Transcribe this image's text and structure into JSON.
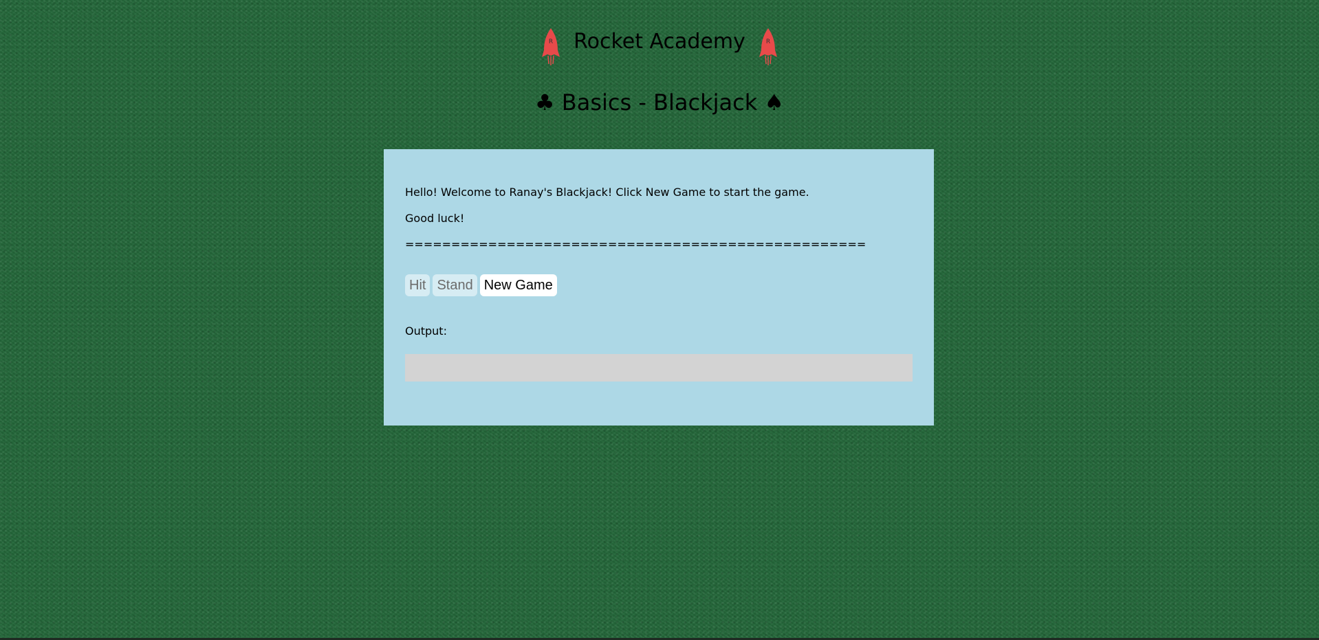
{
  "header": {
    "title": "Rocket Academy",
    "subtitle": "♣ Basics - Blackjack ♠",
    "logo_icon": "rocket-icon",
    "logo_letter": "R",
    "logo_color": "#e84a4a"
  },
  "panel": {
    "background": "#add8e6",
    "messages": [
      "Hello! Welcome to Ranay's Blackjack! Click New Game to start the game.",
      "Good luck!",
      "=================================================="
    ],
    "buttons": {
      "hit": "Hit",
      "stand": "Stand",
      "new_game": "New Game"
    },
    "output_label": "Output:",
    "output_value": ""
  },
  "colors": {
    "felt": "#24683a",
    "output_box": "#d3d3d3"
  }
}
